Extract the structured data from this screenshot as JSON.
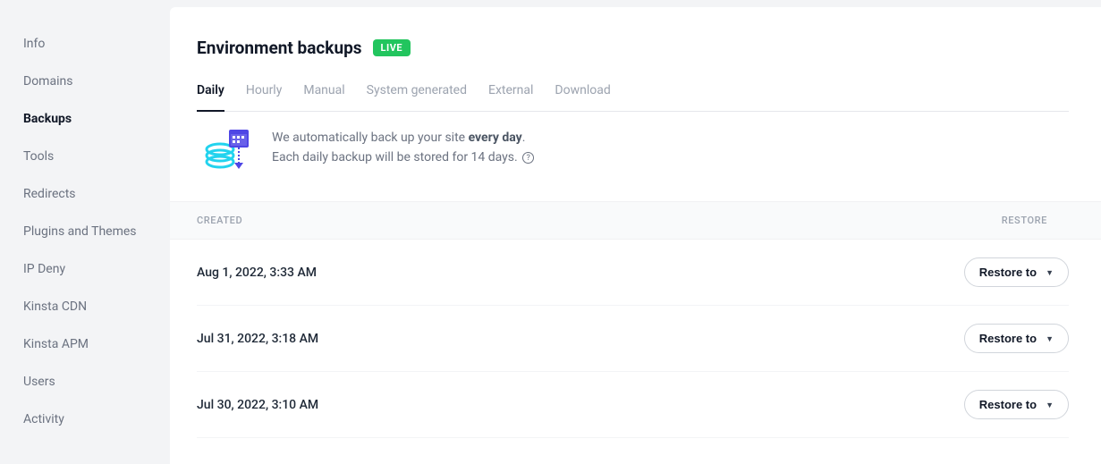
{
  "sidebar": {
    "items": [
      {
        "label": "Info",
        "active": false
      },
      {
        "label": "Domains",
        "active": false
      },
      {
        "label": "Backups",
        "active": true
      },
      {
        "label": "Tools",
        "active": false
      },
      {
        "label": "Redirects",
        "active": false
      },
      {
        "label": "Plugins and Themes",
        "active": false
      },
      {
        "label": "IP Deny",
        "active": false
      },
      {
        "label": "Kinsta CDN",
        "active": false
      },
      {
        "label": "Kinsta APM",
        "active": false
      },
      {
        "label": "Users",
        "active": false
      },
      {
        "label": "Activity",
        "active": false
      }
    ]
  },
  "header": {
    "title": "Environment backups",
    "badge": "LIVE"
  },
  "tabs": [
    {
      "label": "Daily",
      "active": true
    },
    {
      "label": "Hourly",
      "active": false
    },
    {
      "label": "Manual",
      "active": false
    },
    {
      "label": "System generated",
      "active": false
    },
    {
      "label": "External",
      "active": false
    },
    {
      "label": "Download",
      "active": false
    }
  ],
  "banner": {
    "line1_pre": "We automatically back up your site ",
    "line1_bold": "every day",
    "line1_post": ".",
    "line2": "Each daily backup will be stored for 14 days.",
    "help_glyph": "?"
  },
  "columns": {
    "created": "CREATED",
    "restore": "RESTORE"
  },
  "restore_button_label": "Restore to",
  "rows": [
    {
      "created": "Aug 1, 2022, 3:33 AM"
    },
    {
      "created": "Jul 31, 2022, 3:18 AM"
    },
    {
      "created": "Jul 30, 2022, 3:10 AM"
    }
  ],
  "colors": {
    "accent_green": "#22c55e",
    "icon_cyan": "#22d3ee",
    "icon_indigo": "#4f46e5"
  }
}
